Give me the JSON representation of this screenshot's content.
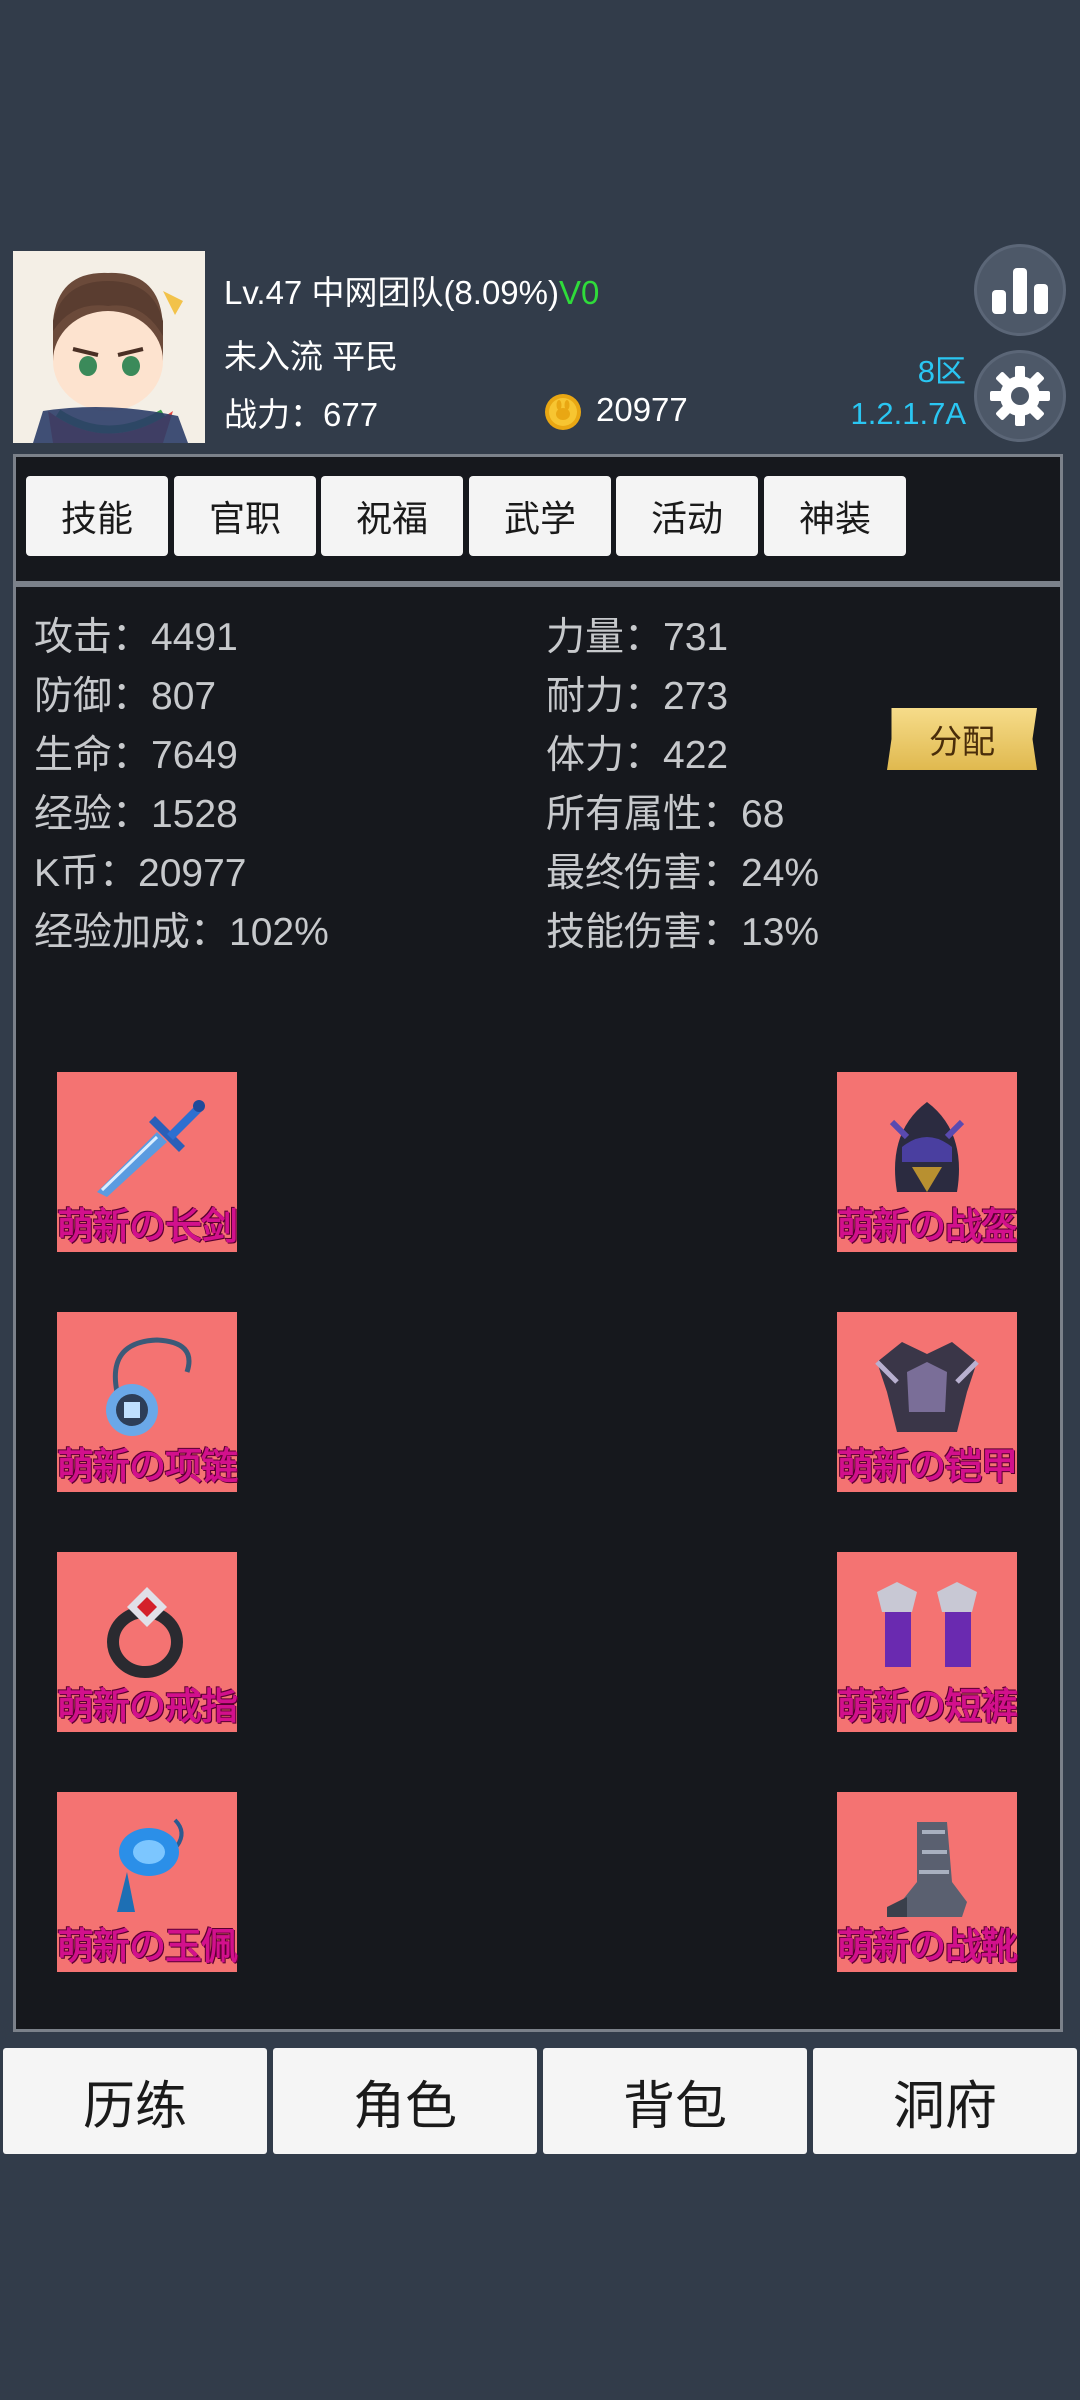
{
  "header": {
    "level_line": "Lv.47 中网团队(8.09%)",
    "vip": "V0",
    "rank_line": "未入流 平民",
    "power": "战力：677",
    "coins": "20977",
    "zone": "8区",
    "version": "1.2.1.7A"
  },
  "tabs": [
    "技能",
    "官职",
    "祝福",
    "武学",
    "活动",
    "神装"
  ],
  "stats": {
    "left": [
      "攻击：4491",
      "防御：807",
      "生命：7649",
      "经验：1528",
      "K币：20977",
      "经验加成：102%"
    ],
    "right": [
      "力量：731",
      "耐力：273",
      "体力：422",
      "所有属性：68",
      "最终伤害：24%",
      "技能伤害：13%"
    ]
  },
  "assign_label": "分配",
  "equipment": {
    "left": [
      "萌新の长剑",
      "萌新の项链",
      "萌新の戒指",
      "萌新の玉佩"
    ],
    "right": [
      "萌新の战盔",
      "萌新の铠甲",
      "萌新の短裤",
      "萌新の战靴"
    ]
  },
  "bottom_nav": [
    "历练",
    "角色",
    "背包",
    "洞府"
  ],
  "icons": {
    "ranking": "bar-chart-icon",
    "settings": "gear-icon",
    "coin": "coin-icon"
  },
  "colors": {
    "background": "#323c4a",
    "panel": "#16181d",
    "slot": "#f47372",
    "item_label": "#d2108c",
    "vip": "#2fdc3a",
    "zone": "#2ac6f2"
  }
}
